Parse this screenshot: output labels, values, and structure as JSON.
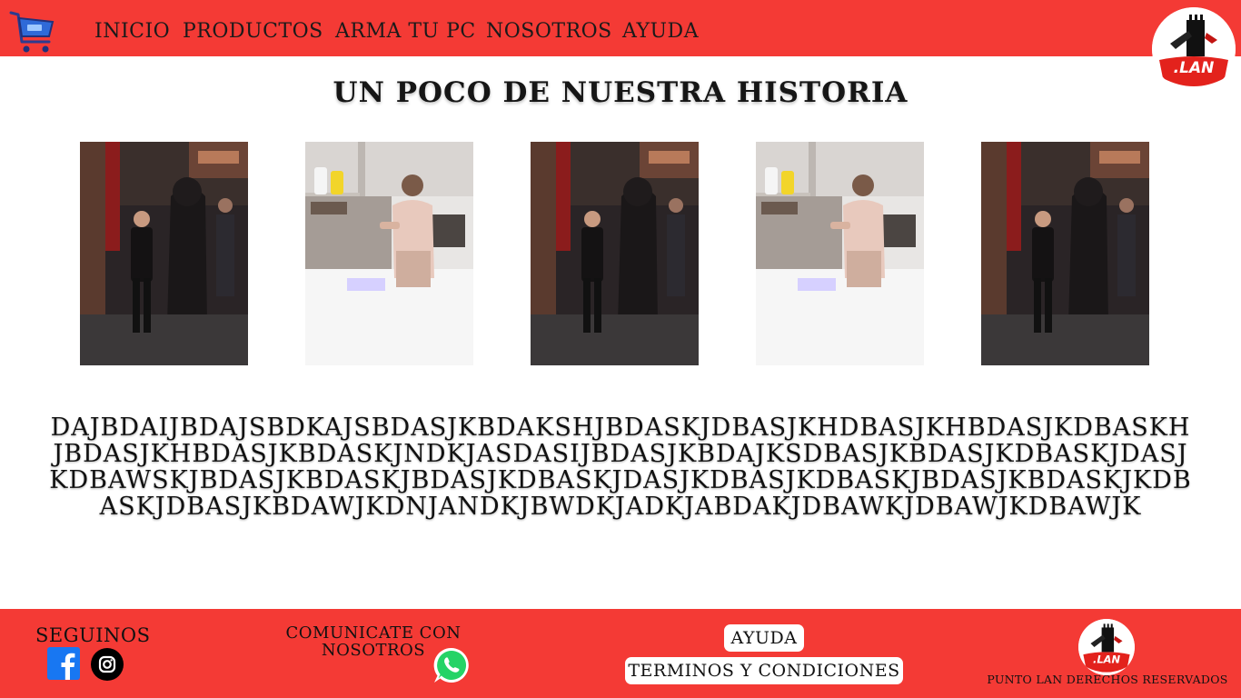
{
  "header": {
    "nav": [
      "INICIO",
      "PRODUCTOS",
      "ARMA TU PC",
      "NOSOTROS",
      "AYUDA"
    ],
    "logo_text": ".LAN",
    "cart_icon": "shopping-cart-icon"
  },
  "main": {
    "title": "UN POCO DE NUESTRA HISTORIA",
    "photos": [
      {
        "scene": "street"
      },
      {
        "scene": "kitchen"
      },
      {
        "scene": "street"
      },
      {
        "scene": "kitchen"
      },
      {
        "scene": "street"
      }
    ],
    "story_text": "DAJBDAIJBDAJSBDKAJSBDASJKBDAKSHJBDASKJDBASJKHDBASJKHBDASJKDBASKHJBDASJKHBDASJKBDASKJNDKJASDASIJBDASJKBDAJKSDBASJKBDASJKDBASKJDASJKDBAWSKJBDASJKBDASKJBDASJKDBASKJDASJKDBASJKDBASKJBDASJKBDASKJKDBASKJDBASJKBDAWJKDNJANDKJBWDKJADKJABDAKJDBAWKJDBAWJKDBAWJK"
  },
  "footer": {
    "follow_label": "SEGUINOS",
    "contact_label": "COMUNICATE CON NOSOTROS",
    "help_label": "AYUDA",
    "terms_label": "TERMINOS Y CONDICIONES",
    "rights_label": "PUNTO LAN DERECHOS RESERVADOS",
    "logo_text": ".LAN",
    "icons": [
      "facebook-icon",
      "instagram-icon",
      "whatsapp-icon"
    ]
  },
  "colors": {
    "brand_red": "#f43a35",
    "white": "#ffffff"
  }
}
